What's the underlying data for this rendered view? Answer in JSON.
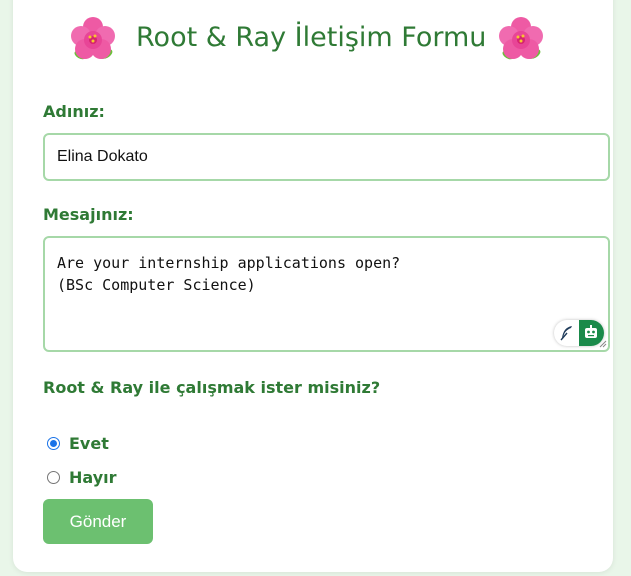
{
  "form": {
    "title": "Root & Ray İletişim Formu",
    "name_label": "Adınız:",
    "name_value": "Elina Dokato",
    "message_label": "Mesajınız:",
    "message_value": "Are your internship applications open?\n(BSc Computer Science)",
    "question": "Root & Ray ile çalışmak ister misiniz?",
    "options": [
      {
        "label": "Evet",
        "checked": true
      },
      {
        "label": "Hayır",
        "checked": false
      }
    ],
    "submit_label": "Gönder"
  },
  "icons": {
    "title_left": "hibiscus-flower-icon",
    "title_right": "hibiscus-flower-icon",
    "textarea_tools": [
      "feather-icon",
      "robot-icon"
    ],
    "textarea_resize": "resize-grip-icon"
  },
  "colors": {
    "background": "#e9f6e9",
    "accent_green": "#2f7a35",
    "input_border": "#a6d8a8",
    "button": "#6cc070",
    "radio_selected": "#1a73e8"
  }
}
